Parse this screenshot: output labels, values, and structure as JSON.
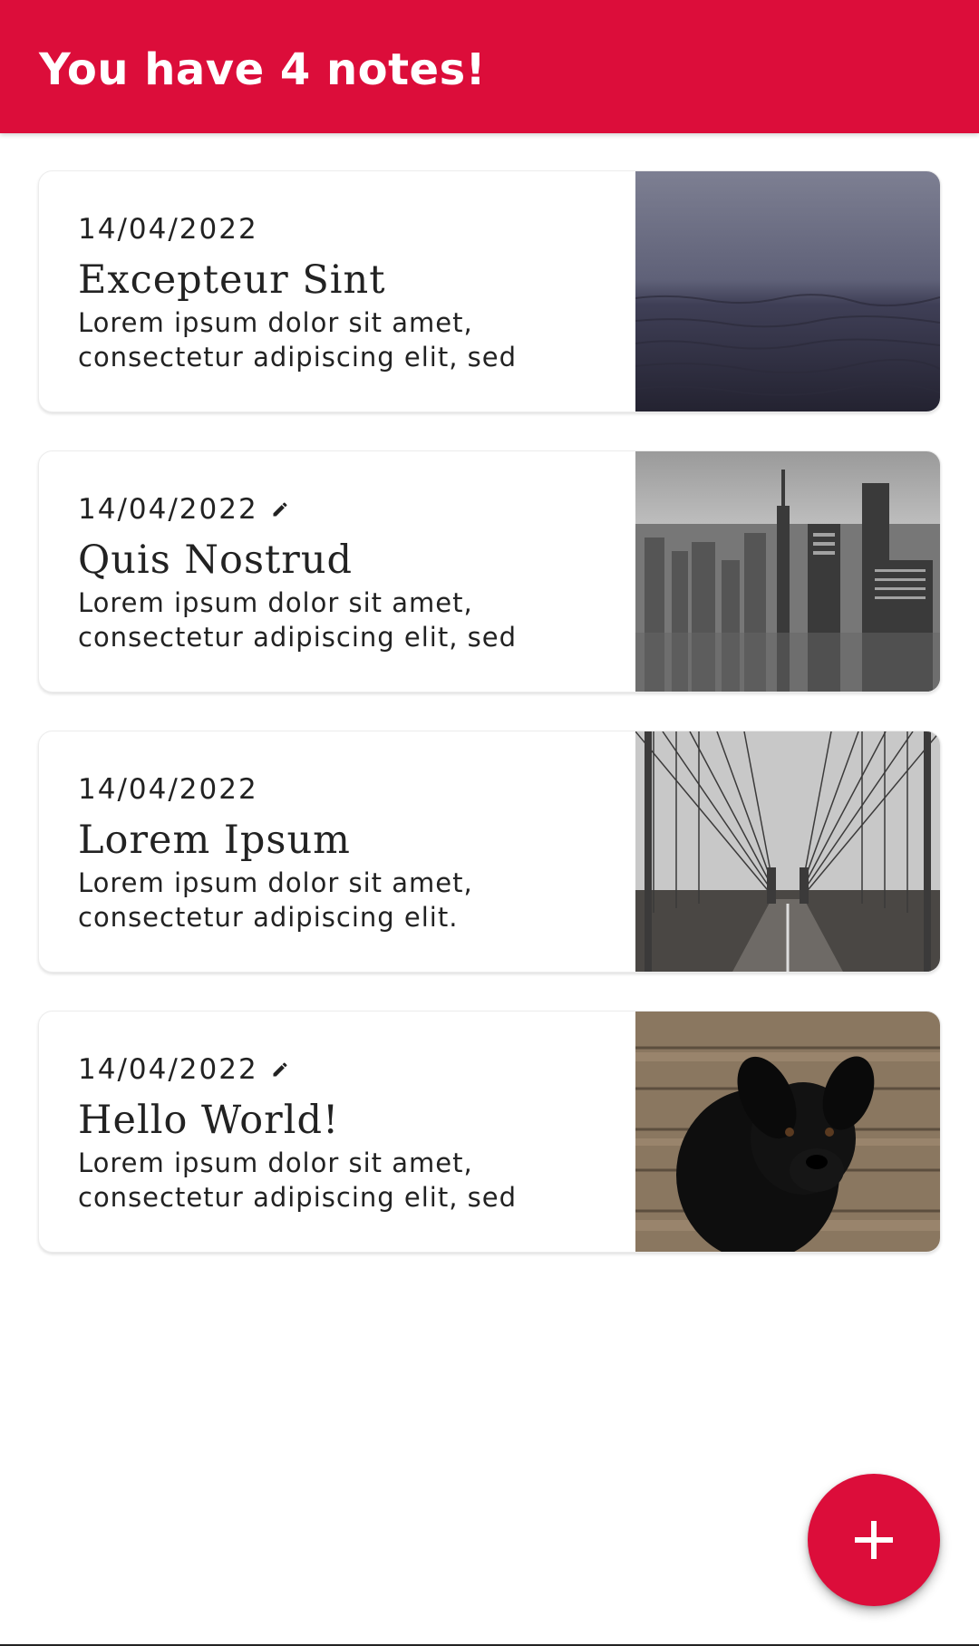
{
  "appbar": {
    "title": "You have 4 notes!",
    "color": "#DC0D3A"
  },
  "notes": [
    {
      "date": "14/04/2022",
      "edited": false,
      "title": "Excepteur Sint",
      "body": "Lorem ipsum dolor sit amet, consectetur adipiscing elit, sed",
      "image": "foggy-sea-photo"
    },
    {
      "date": "14/04/2022",
      "edited": true,
      "title": "Quis Nostrud",
      "body": "Lorem ipsum dolor sit amet, consectetur adipiscing elit, sed",
      "image": "city-skyline-photo"
    },
    {
      "date": "14/04/2022",
      "edited": false,
      "title": "Lorem Ipsum",
      "body": "Lorem ipsum dolor sit amet, consectetur adipiscing elit.",
      "image": "bridge-photo"
    },
    {
      "date": "14/04/2022",
      "edited": true,
      "title": "Hello World!",
      "body": "Lorem ipsum dolor sit amet, consectetur adipiscing elit, sed",
      "image": "black-puppy-photo"
    }
  ],
  "fab": {
    "icon": "plus-icon"
  }
}
